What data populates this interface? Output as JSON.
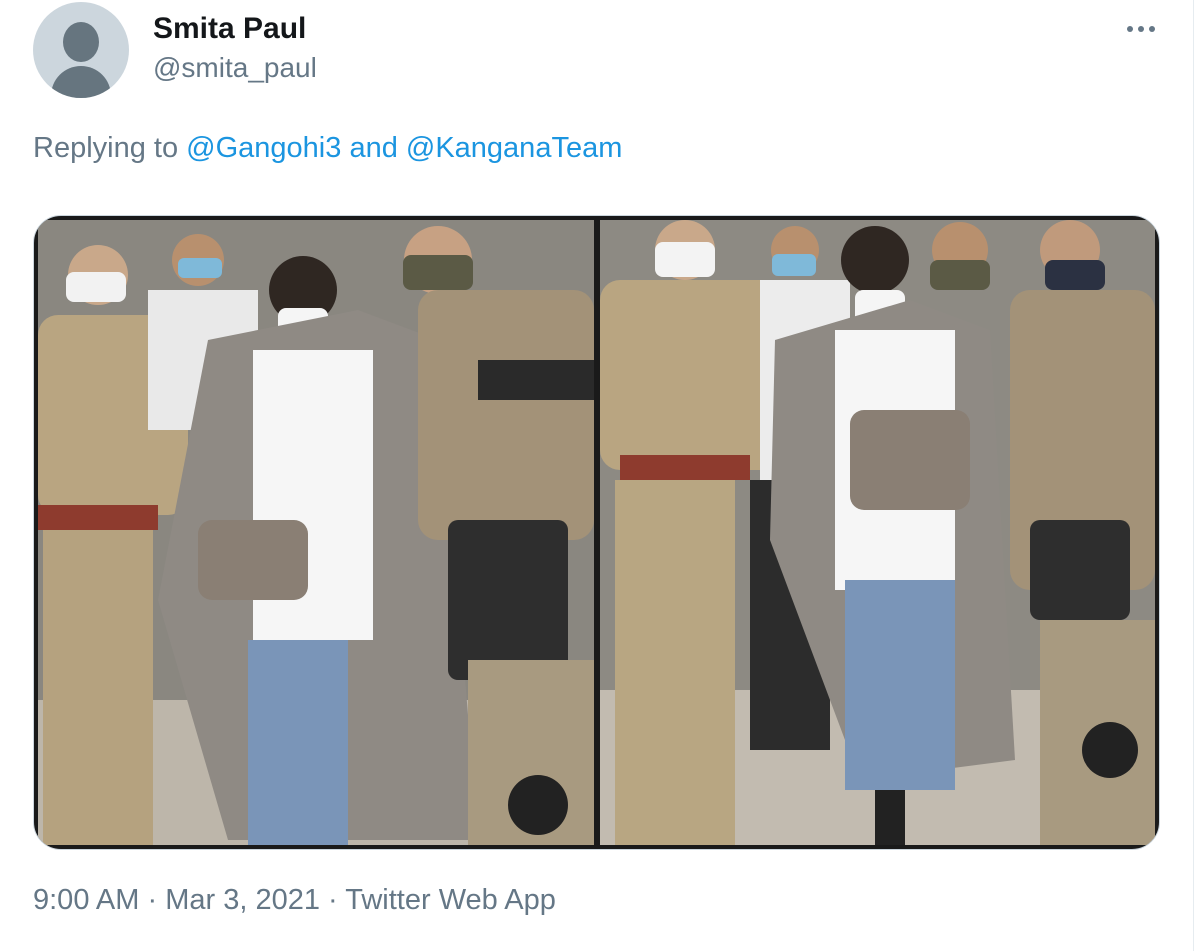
{
  "tweet": {
    "author": {
      "display_name": "Smita Paul",
      "handle": "@smita_paul"
    },
    "reply": {
      "prefix": "Replying to",
      "mention_1": "@Gangohi3",
      "conjunction": "and",
      "mention_2": "@KanganaTeam"
    },
    "media": {
      "left_image": "photo of a woman in a checked long coat walking with a grey handbag, escorted by police officers and armed security",
      "right_image": "photo of the same woman in a checked coat and ripped jeans carrying a grey handbag, flanked by police and commandos"
    },
    "meta": {
      "time": "9:00 AM",
      "separator": "·",
      "date": "Mar 3, 2021",
      "source": "Twitter Web App"
    },
    "icons": {
      "avatar": "default-profile-icon",
      "more": "more-options-icon"
    },
    "colors": {
      "link": "#1b95e0",
      "secondary_text": "#657786",
      "primary_text": "#14171a",
      "border": "#ccd6dd"
    }
  }
}
